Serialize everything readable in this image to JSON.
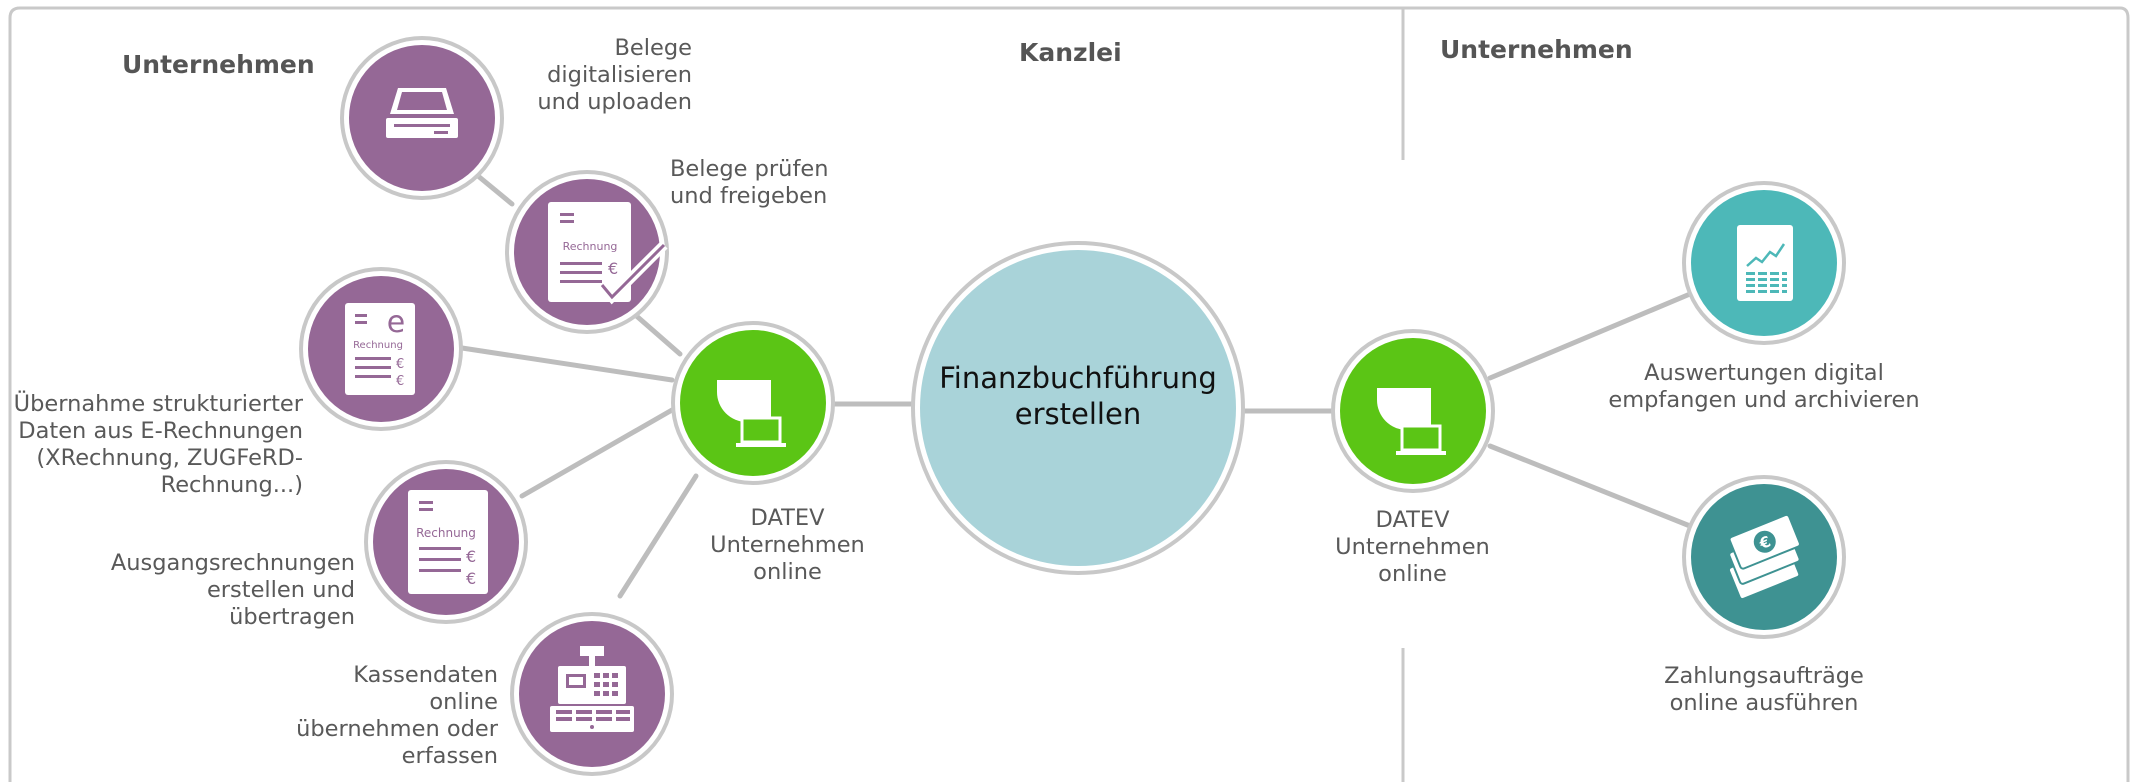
{
  "headers": {
    "left": "Unternehmen",
    "middle": "Kanzlei",
    "right": "Unternehmen"
  },
  "center_node": {
    "line1": "Finanzbuchführung",
    "line2": "erstellen"
  },
  "left_hub": {
    "line1": "DATEV",
    "line2": "Unternehmen",
    "line3": "online"
  },
  "right_hub": {
    "line1": "DATEV",
    "line2": "Unternehmen",
    "line3": "online"
  },
  "left_nodes": {
    "scan": {
      "line1": "Belege",
      "line2": "digitalisieren",
      "line3": "und uploaden"
    },
    "check": {
      "line1": "Belege prüfen",
      "line2": "und freigeben",
      "icon_text": "Rechnung"
    },
    "einvoice": {
      "line1": "Übernahme strukturierter",
      "line2": "Daten aus E-Rechnungen",
      "line3": "(XRechnung, ZUGFeRD-",
      "line4": "Rechnung...)",
      "icon_text": "Rechnung"
    },
    "outgoing": {
      "line1": "Ausgangsrechnungen",
      "line2": "erstellen und",
      "line3": "übertragen",
      "icon_text": "Rechnung"
    },
    "cash": {
      "line1": "Kassendaten",
      "line2": "online",
      "line3": "übernehmen oder",
      "line4": "erfassen"
    }
  },
  "right_nodes": {
    "reports": {
      "line1": "Auswertungen digital",
      "line2": "empfangen und archivieren"
    },
    "payments": {
      "line1": "Zahlungsaufträge",
      "line2": "online ausführen"
    }
  },
  "colors": {
    "purple": "#956896",
    "green": "#5bc515",
    "light_blue": "#a9d3d9",
    "teal": "#4db8b8",
    "dark_teal": "#3e9292",
    "ring": "#c8c8c8",
    "connector": "#bdbdbd"
  },
  "icons": {
    "scan": "scanner-icon",
    "check": "invoice-check-icon",
    "einvoice": "e-invoice-icon",
    "outgoing": "invoice-icon",
    "cash": "cash-register-icon",
    "hub": "datev-laptop-icon",
    "reports": "report-chart-icon",
    "payments": "banknotes-euro-icon"
  }
}
